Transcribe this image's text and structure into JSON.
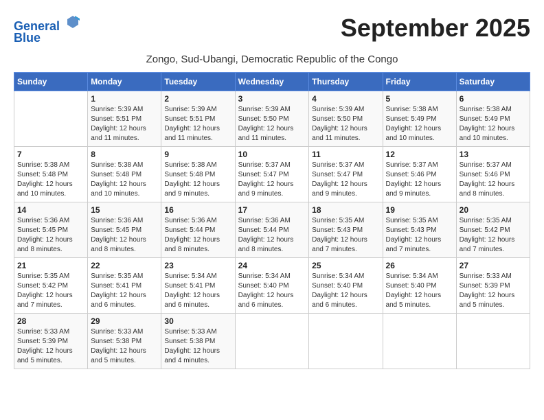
{
  "header": {
    "logo_line1": "General",
    "logo_line2": "Blue",
    "month_title": "September 2025",
    "location": "Zongo, Sud-Ubangi, Democratic Republic of the Congo"
  },
  "calendar": {
    "days_of_week": [
      "Sunday",
      "Monday",
      "Tuesday",
      "Wednesday",
      "Thursday",
      "Friday",
      "Saturday"
    ],
    "weeks": [
      [
        {
          "day": "",
          "info": ""
        },
        {
          "day": "1",
          "info": "Sunrise: 5:39 AM\nSunset: 5:51 PM\nDaylight: 12 hours\nand 11 minutes."
        },
        {
          "day": "2",
          "info": "Sunrise: 5:39 AM\nSunset: 5:51 PM\nDaylight: 12 hours\nand 11 minutes."
        },
        {
          "day": "3",
          "info": "Sunrise: 5:39 AM\nSunset: 5:50 PM\nDaylight: 12 hours\nand 11 minutes."
        },
        {
          "day": "4",
          "info": "Sunrise: 5:39 AM\nSunset: 5:50 PM\nDaylight: 12 hours\nand 11 minutes."
        },
        {
          "day": "5",
          "info": "Sunrise: 5:38 AM\nSunset: 5:49 PM\nDaylight: 12 hours\nand 10 minutes."
        },
        {
          "day": "6",
          "info": "Sunrise: 5:38 AM\nSunset: 5:49 PM\nDaylight: 12 hours\nand 10 minutes."
        }
      ],
      [
        {
          "day": "7",
          "info": "Sunrise: 5:38 AM\nSunset: 5:48 PM\nDaylight: 12 hours\nand 10 minutes."
        },
        {
          "day": "8",
          "info": "Sunrise: 5:38 AM\nSunset: 5:48 PM\nDaylight: 12 hours\nand 10 minutes."
        },
        {
          "day": "9",
          "info": "Sunrise: 5:38 AM\nSunset: 5:48 PM\nDaylight: 12 hours\nand 9 minutes."
        },
        {
          "day": "10",
          "info": "Sunrise: 5:37 AM\nSunset: 5:47 PM\nDaylight: 12 hours\nand 9 minutes."
        },
        {
          "day": "11",
          "info": "Sunrise: 5:37 AM\nSunset: 5:47 PM\nDaylight: 12 hours\nand 9 minutes."
        },
        {
          "day": "12",
          "info": "Sunrise: 5:37 AM\nSunset: 5:46 PM\nDaylight: 12 hours\nand 9 minutes."
        },
        {
          "day": "13",
          "info": "Sunrise: 5:37 AM\nSunset: 5:46 PM\nDaylight: 12 hours\nand 8 minutes."
        }
      ],
      [
        {
          "day": "14",
          "info": "Sunrise: 5:36 AM\nSunset: 5:45 PM\nDaylight: 12 hours\nand 8 minutes."
        },
        {
          "day": "15",
          "info": "Sunrise: 5:36 AM\nSunset: 5:45 PM\nDaylight: 12 hours\nand 8 minutes."
        },
        {
          "day": "16",
          "info": "Sunrise: 5:36 AM\nSunset: 5:44 PM\nDaylight: 12 hours\nand 8 minutes."
        },
        {
          "day": "17",
          "info": "Sunrise: 5:36 AM\nSunset: 5:44 PM\nDaylight: 12 hours\nand 8 minutes."
        },
        {
          "day": "18",
          "info": "Sunrise: 5:35 AM\nSunset: 5:43 PM\nDaylight: 12 hours\nand 7 minutes."
        },
        {
          "day": "19",
          "info": "Sunrise: 5:35 AM\nSunset: 5:43 PM\nDaylight: 12 hours\nand 7 minutes."
        },
        {
          "day": "20",
          "info": "Sunrise: 5:35 AM\nSunset: 5:42 PM\nDaylight: 12 hours\nand 7 minutes."
        }
      ],
      [
        {
          "day": "21",
          "info": "Sunrise: 5:35 AM\nSunset: 5:42 PM\nDaylight: 12 hours\nand 7 minutes."
        },
        {
          "day": "22",
          "info": "Sunrise: 5:35 AM\nSunset: 5:41 PM\nDaylight: 12 hours\nand 6 minutes."
        },
        {
          "day": "23",
          "info": "Sunrise: 5:34 AM\nSunset: 5:41 PM\nDaylight: 12 hours\nand 6 minutes."
        },
        {
          "day": "24",
          "info": "Sunrise: 5:34 AM\nSunset: 5:40 PM\nDaylight: 12 hours\nand 6 minutes."
        },
        {
          "day": "25",
          "info": "Sunrise: 5:34 AM\nSunset: 5:40 PM\nDaylight: 12 hours\nand 6 minutes."
        },
        {
          "day": "26",
          "info": "Sunrise: 5:34 AM\nSunset: 5:40 PM\nDaylight: 12 hours\nand 5 minutes."
        },
        {
          "day": "27",
          "info": "Sunrise: 5:33 AM\nSunset: 5:39 PM\nDaylight: 12 hours\nand 5 minutes."
        }
      ],
      [
        {
          "day": "28",
          "info": "Sunrise: 5:33 AM\nSunset: 5:39 PM\nDaylight: 12 hours\nand 5 minutes."
        },
        {
          "day": "29",
          "info": "Sunrise: 5:33 AM\nSunset: 5:38 PM\nDaylight: 12 hours\nand 5 minutes."
        },
        {
          "day": "30",
          "info": "Sunrise: 5:33 AM\nSunset: 5:38 PM\nDaylight: 12 hours\nand 4 minutes."
        },
        {
          "day": "",
          "info": ""
        },
        {
          "day": "",
          "info": ""
        },
        {
          "day": "",
          "info": ""
        },
        {
          "day": "",
          "info": ""
        }
      ]
    ]
  }
}
